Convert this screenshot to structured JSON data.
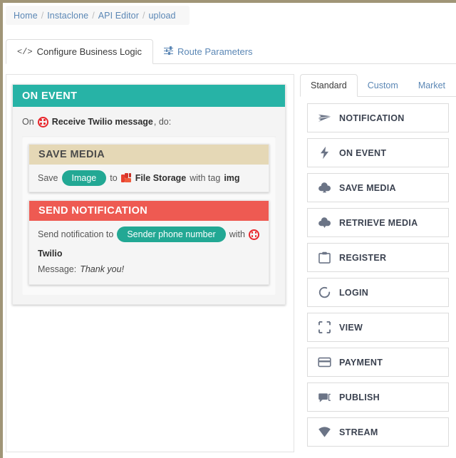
{
  "breadcrumb": {
    "items": [
      "Home",
      "Instaclone",
      "API Editor",
      "upload"
    ],
    "separator": "/"
  },
  "main_tabs": [
    {
      "label": "Configure Business Logic",
      "icon": "code-icon",
      "active": true
    },
    {
      "label": "Route Parameters",
      "icon": "sliders-icon",
      "active": false
    }
  ],
  "logic": {
    "on_event": {
      "title": "ON EVENT",
      "header_color": "#27b3a6",
      "prefix": "On",
      "trigger_icon": "twilio-icon",
      "trigger": "Receive Twilio message",
      "suffix": ", do:"
    },
    "save_media": {
      "title": "SAVE MEDIA",
      "header_color": "#e5d8b6",
      "word_save": "Save",
      "source_pill": "Image",
      "word_to": "to",
      "destination_icon": "file-storage-icon",
      "destination": "File Storage",
      "word_with_tag": "with tag",
      "tag": "img"
    },
    "send_notification": {
      "title": "SEND NOTIFICATION",
      "header_color": "#ee5a52",
      "prefix": "Send notification to",
      "recipient_pill": "Sender phone number",
      "word_with": "with",
      "provider_icon": "twilio-icon",
      "provider": "Twilio",
      "message_label": "Message:",
      "message_value": "Thank you!"
    }
  },
  "palette": {
    "tabs": [
      {
        "label": "Standard",
        "active": true
      },
      {
        "label": "Custom",
        "active": false
      },
      {
        "label": "Market",
        "active": false
      }
    ],
    "items": [
      {
        "label": "NOTIFICATION",
        "icon": "paper-plane-icon"
      },
      {
        "label": "ON EVENT",
        "icon": "lightning-bolt-icon"
      },
      {
        "label": "SAVE MEDIA",
        "icon": "cloud-upload-icon"
      },
      {
        "label": "RETRIEVE MEDIA",
        "icon": "cloud-download-icon"
      },
      {
        "label": "REGISTER",
        "icon": "clipboard-icon"
      },
      {
        "label": "LOGIN",
        "icon": "circle-arrow-icon"
      },
      {
        "label": "VIEW",
        "icon": "crop-corners-icon"
      },
      {
        "label": "PAYMENT",
        "icon": "credit-card-icon"
      },
      {
        "label": "PUBLISH",
        "icon": "chat-bubble-icon"
      },
      {
        "label": "STREAM",
        "icon": "wifi-fan-icon"
      }
    ]
  },
  "colors": {
    "teal": "#27b3a6",
    "pill_teal": "#22a894",
    "red": "#ee5a52",
    "beige": "#e5d8b6",
    "link_blue": "#5b87b5",
    "twilio_red": "#e8262b"
  }
}
